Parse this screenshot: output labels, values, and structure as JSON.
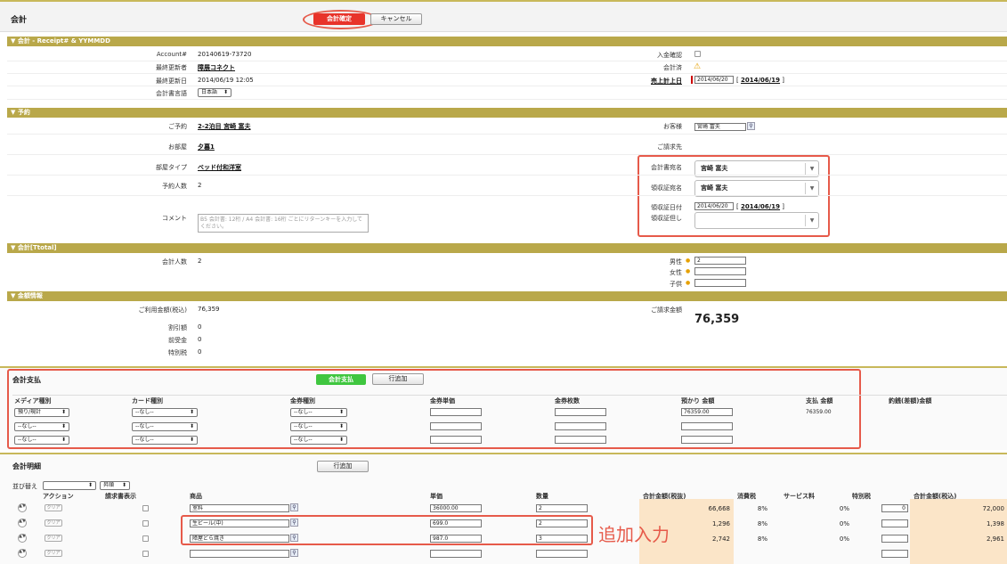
{
  "header": {
    "title": "会計",
    "confirm_button": "会計確定",
    "cancel_button": "キャンセル"
  },
  "sec_receipt": {
    "title": "▼ 会計 - Receipt# & YYMMDD",
    "account_label": "Account#",
    "account_value": "20140619-73720",
    "updater_label": "最終更新者",
    "updater_value": "障展コネクト",
    "updated_label": "最終更新日",
    "updated_value": "2014/06/19 12:05",
    "lang_label": "会計書言語",
    "lang_value": "日本語",
    "payment_confirm_label": "入金確認",
    "accounted_label": "会計済",
    "sales_date_label": "売上計上日",
    "sales_date_value": "2014/06/20",
    "sales_date_link": "2014/06/19"
  },
  "sec_booking": {
    "title": "▼ 予約",
    "booking_label": "ご予約",
    "booking_value": "2-2泊目 宮崎 富夫",
    "room_label": "お部屋",
    "room_value": "夕暮1",
    "roomtype_label": "部屋タイプ",
    "roomtype_value": "ベッド付和洋室",
    "people_label": "予約人数",
    "people_value": "2",
    "comment_label": "コメント",
    "comment_placeholder": "B5 会計書: 12桁 / A4 会計書: 16桁 ごとにリターンキーを入力してください。",
    "guest_label": "お客様",
    "guest_value": "宮崎 富夫",
    "billing_label": "ご請求先",
    "invoice_name_label": "会計書宛名",
    "invoice_name_value": "宮崎 富夫",
    "receipt_name_label": "領収証宛名",
    "receipt_name_value": "宮崎 富夫",
    "receipt_date_label": "領収証日付",
    "receipt_date_value": "2014/06/20",
    "receipt_date_link": "2014/06/19",
    "receipt_note_label": "領収証但し",
    "receipt_note_value": ""
  },
  "sec_total": {
    "title": "▼ 会計[Ttotal]",
    "people_label": "会計人数",
    "people_value": "2",
    "male_label": "男性",
    "male_value": "2",
    "female_label": "女性",
    "female_value": "",
    "child_label": "子供",
    "child_value": ""
  },
  "sec_amount": {
    "title": "▼ 金額情報",
    "usage_label": "ご利用金額(税込)",
    "usage_value": "76,359",
    "discount_label": "割引額",
    "discount_value": "0",
    "advance_label": "前受金",
    "advance_value": "0",
    "special_label": "特別税",
    "special_value": "0",
    "billed_label": "ご請求金額",
    "billed_value": "76,359"
  },
  "payment": {
    "title": "会計支払",
    "pay_button": "会計支払",
    "add_row_button": "行追加",
    "columns": [
      "メディア種別",
      "カード種別",
      "金券種別",
      "金券単価",
      "金券枚数",
      "預かり 金額",
      "支払 金額",
      "釣銭(差額)金額"
    ],
    "rows": [
      {
        "media": "預り/現計",
        "card": "--なし--",
        "voucher": "--なし--",
        "unit": "",
        "count": "",
        "deposit": "76359.00",
        "paid": "76359.00"
      },
      {
        "media": "--なし--",
        "card": "--なし--",
        "voucher": "--なし--",
        "unit": "",
        "count": "",
        "deposit": "",
        "paid": ""
      },
      {
        "media": "--なし--",
        "card": "--なし--",
        "voucher": "--なし--",
        "unit": "",
        "count": "",
        "deposit": "",
        "paid": ""
      }
    ]
  },
  "details": {
    "title": "会計明細",
    "add_row_button": "行追加",
    "sort_label": "並び替え",
    "sort_order": "昇順",
    "columns": [
      "アクション",
      "請求書表示",
      "商品",
      "単価",
      "数量",
      "合計金額(税抜)",
      "消費税",
      "サービス料",
      "特別税",
      "合計金額(税込)"
    ],
    "clear_label": "クリア",
    "rows": [
      {
        "product": "室料",
        "price": "36000.00",
        "qty": "2",
        "subtotal": "66,668",
        "tax": "8%",
        "service": "0%",
        "special": "0",
        "total": "72,000"
      },
      {
        "product": "生ビール(中)",
        "price": "699.0",
        "qty": "2",
        "subtotal": "1,296",
        "tax": "8%",
        "service": "0%",
        "special": "",
        "total": "1,398"
      },
      {
        "product": "障屋どら焼き",
        "price": "987.0",
        "qty": "3",
        "subtotal": "2,742",
        "tax": "8%",
        "service": "0%",
        "special": "",
        "total": "2,961"
      },
      {
        "product": "",
        "price": "",
        "qty": "",
        "subtotal": "",
        "tax": "",
        "service": "",
        "special": "",
        "total": ""
      }
    ],
    "annotation": "追加入力"
  },
  "colors": {
    "accent_red": "#e8332a",
    "section_gold": "#b9a84a",
    "highlight_red": "#e65a4a",
    "pay_green": "#3fc63f",
    "peach": "#fbe5c8"
  }
}
